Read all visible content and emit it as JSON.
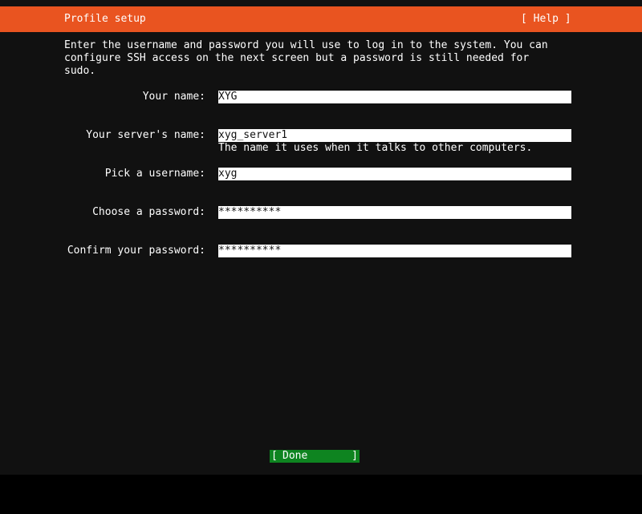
{
  "header": {
    "title": "Profile setup",
    "help_label": "[ Help ]"
  },
  "intro": "Enter the username and password you will use to log in to the system. You can\nconfigure SSH access on the next screen but a password is still needed for\nsudo.",
  "form": {
    "fields": [
      {
        "label": "Your name:",
        "value": "XYG"
      },
      {
        "label": "Your server's name:",
        "value": "xyg_server1",
        "hint": "The name it uses when it talks to other computers."
      },
      {
        "label": "Pick a username:",
        "value": "xyg"
      },
      {
        "label": "Choose a password:",
        "value": "**********"
      },
      {
        "label": "Confirm your password:",
        "value": "**********"
      }
    ]
  },
  "footer": {
    "done_left_bracket": "[",
    "done_label": "Done",
    "done_right_bracket": "]"
  },
  "colors": {
    "header": "#e95420",
    "background": "#111111",
    "done_button": "#0e8420"
  }
}
